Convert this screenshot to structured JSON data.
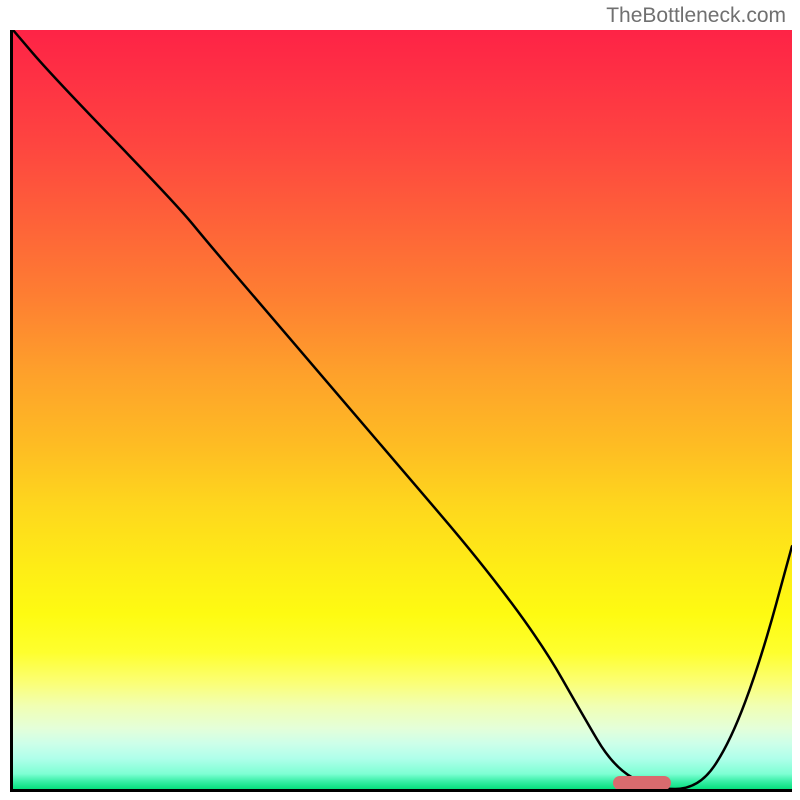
{
  "watermark": "TheBottleneck.com",
  "chart_data": {
    "type": "line",
    "title": "",
    "xlabel": "",
    "ylabel": "",
    "xlim": [
      0,
      100
    ],
    "ylim": [
      0,
      100
    ],
    "x": [
      0,
      5,
      21,
      25,
      30,
      40,
      50,
      60,
      68,
      73,
      77,
      82,
      88,
      92,
      96,
      100
    ],
    "values": [
      100,
      94,
      77,
      72,
      66,
      54,
      42,
      30,
      19,
      10,
      3,
      0,
      0,
      6,
      17,
      32
    ],
    "gradient_stops": [
      {
        "pos": 0,
        "color": "#fe2346"
      },
      {
        "pos": 50,
        "color": "#feb028"
      },
      {
        "pos": 78,
        "color": "#feff20"
      },
      {
        "pos": 100,
        "color": "#06e07e"
      }
    ],
    "marker": {
      "x_start": 77,
      "x_end": 84.5,
      "y": 0.8
    }
  }
}
